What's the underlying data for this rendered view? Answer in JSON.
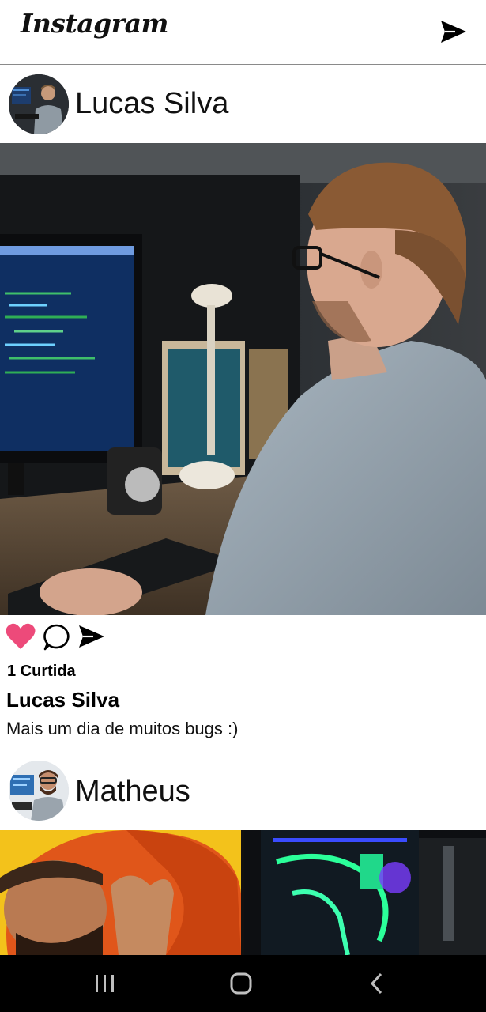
{
  "header": {
    "logo": "Instagram",
    "dm_icon": "paper-plane-icon"
  },
  "posts": [
    {
      "username": "Lucas Silva",
      "avatar_icon": "avatar-photo",
      "image_desc_icon": "post-photo",
      "actions": {
        "like_icon": "heart-filled-icon",
        "comment_icon": "comment-bubble-icon",
        "share_icon": "paper-plane-icon",
        "like_color": "#ed4a7a"
      },
      "likes": "1 Curtida",
      "caption_user": "Lucas Silva",
      "caption_text": "Mais um dia de muitos bugs :)"
    },
    {
      "username": "Matheus",
      "avatar_icon": "avatar-photo",
      "image_desc_icon": "post-photo"
    }
  ],
  "navbar": {
    "recent_icon": "recent-apps-icon",
    "home_icon": "home-circle-icon",
    "back_icon": "back-chevron-icon"
  }
}
